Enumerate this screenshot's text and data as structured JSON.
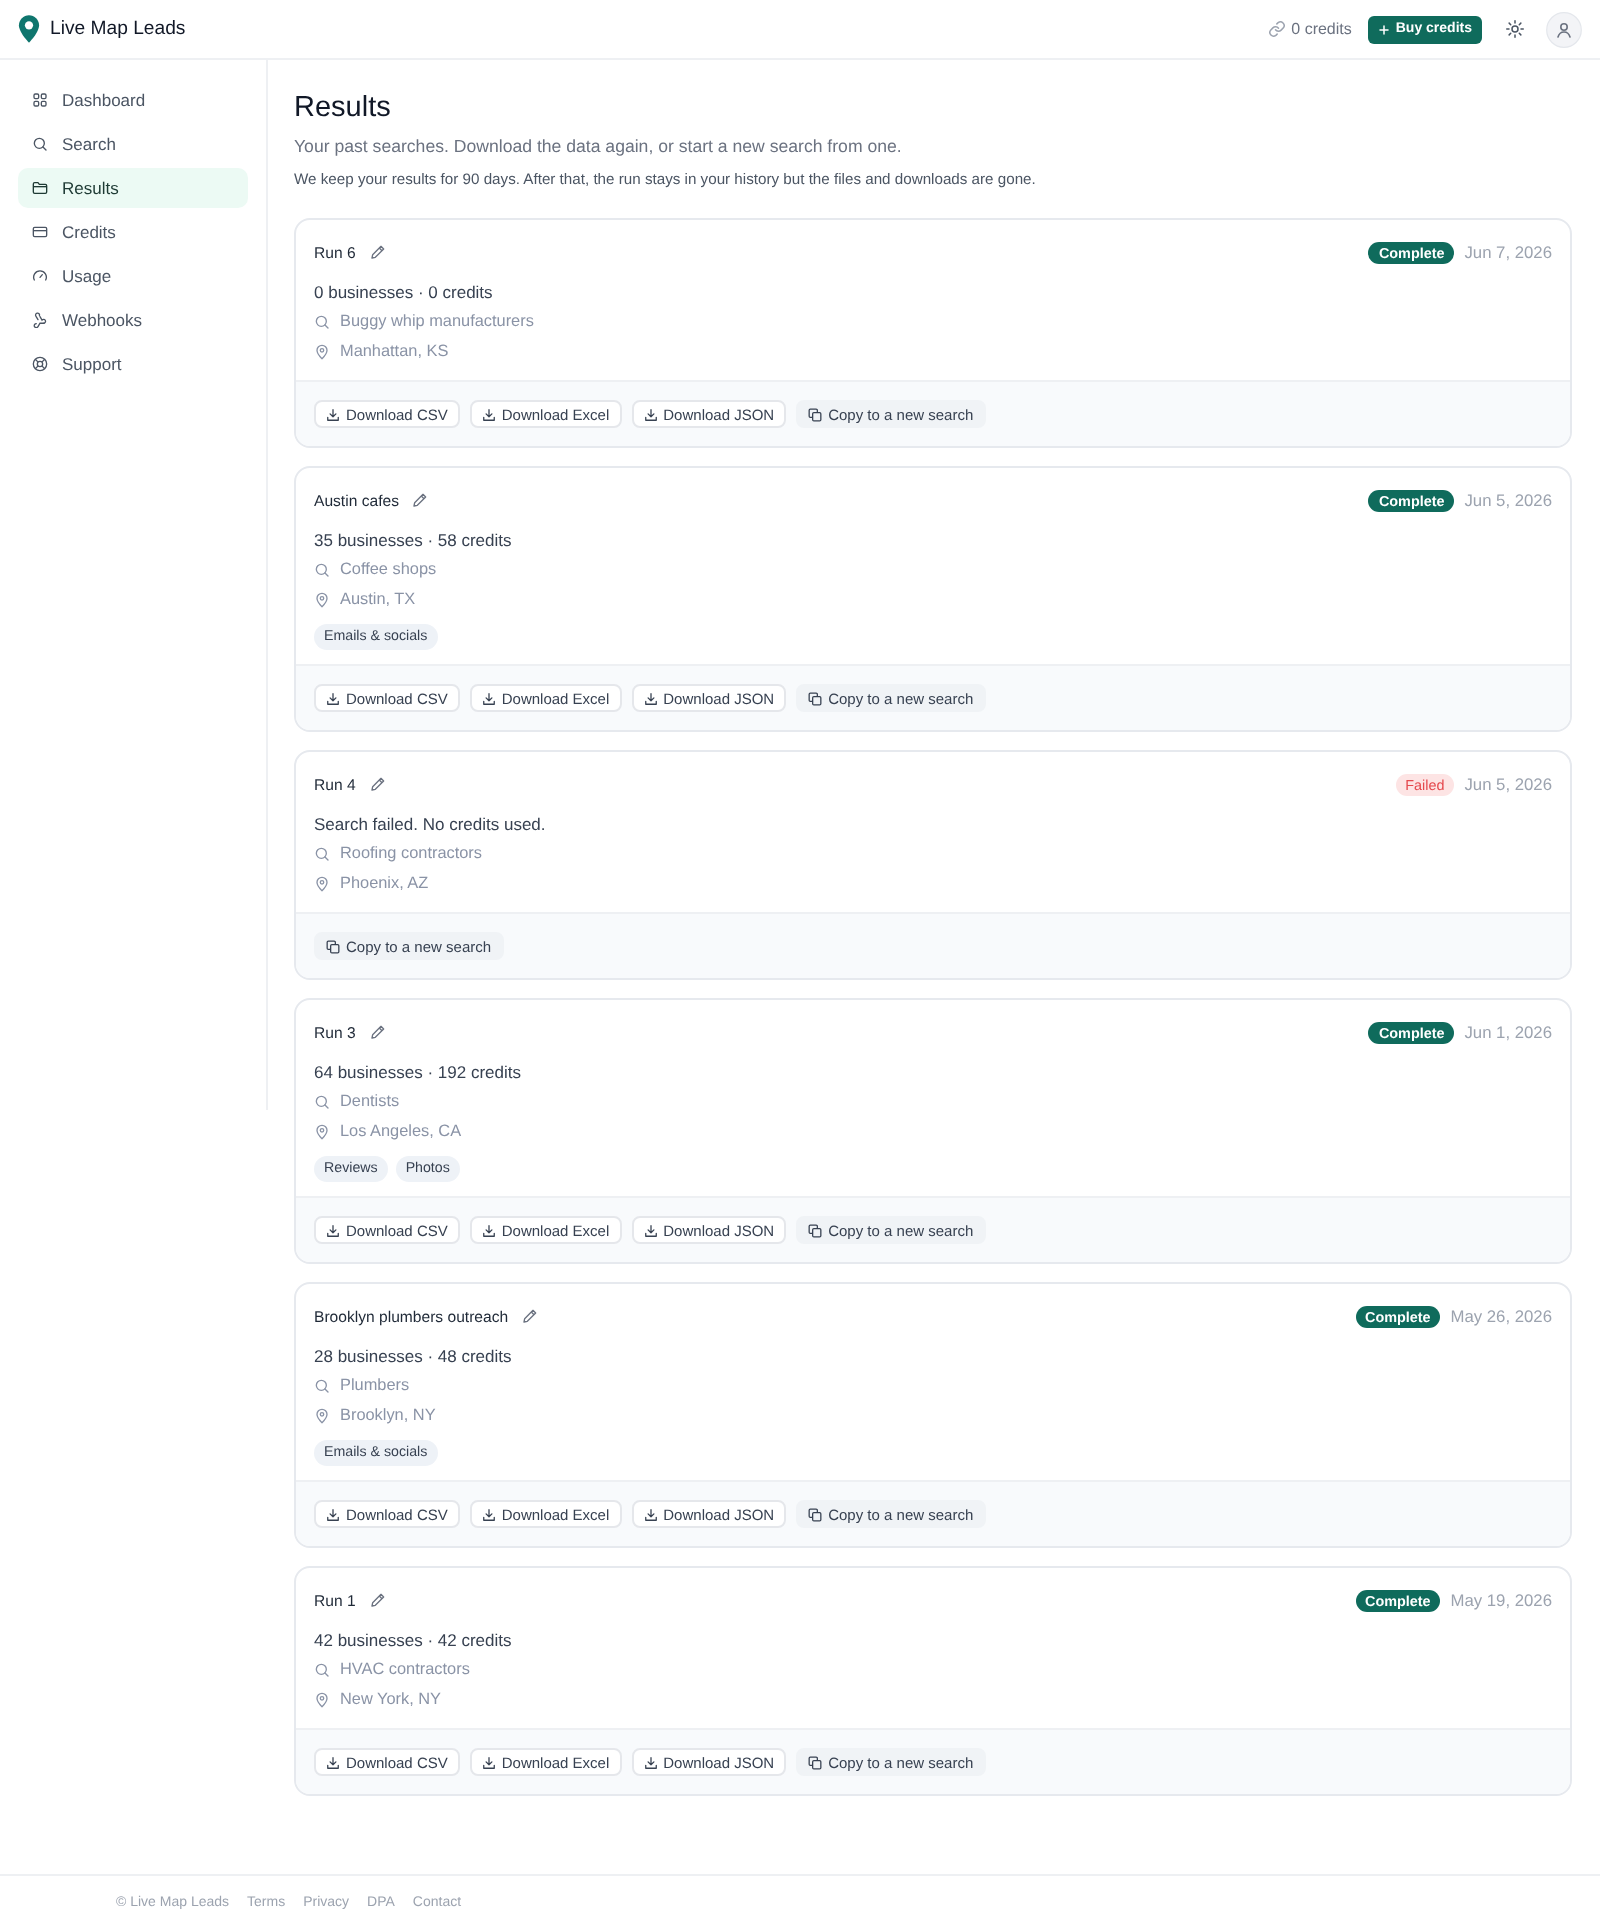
{
  "header": {
    "brand": "Live Map Leads",
    "credits": "0 credits",
    "buy_button": "Buy credits"
  },
  "sidebar": {
    "items": [
      {
        "label": "Dashboard",
        "selected": false
      },
      {
        "label": "Search",
        "selected": false
      },
      {
        "label": "Results",
        "selected": true
      },
      {
        "label": "Credits",
        "selected": false
      },
      {
        "label": "Usage",
        "selected": false
      },
      {
        "label": "Webhooks",
        "selected": false
      },
      {
        "label": "Support",
        "selected": false
      }
    ]
  },
  "page": {
    "title": "Results",
    "subtitle": "Your past searches. Download the data again, or start a new search from one.",
    "note": "We keep your results for 90 days. After that, the run stays in your history but the files and downloads are gone."
  },
  "runs": [
    {
      "name": "Run 6",
      "status": {
        "kind": "complete",
        "label": "Complete"
      },
      "date": "Jun 7, 2026",
      "summary": "0 businesses · 0 credits",
      "query": "Buggy whip manufacturers",
      "location": "Manhattan, KS",
      "actions": [
        {
          "kind": "download",
          "label": "Download CSV"
        },
        {
          "kind": "download",
          "label": "Download Excel"
        },
        {
          "kind": "download",
          "label": "Download JSON"
        },
        {
          "kind": "copy",
          "label": "Copy to a new search"
        }
      ]
    },
    {
      "name": "Austin cafes",
      "status": {
        "kind": "complete",
        "label": "Complete"
      },
      "date": "Jun 5, 2026",
      "summary": "35 businesses · 58 credits",
      "query": "Coffee shops",
      "location": "Austin, TX",
      "tags": [
        "Emails & socials"
      ],
      "actions": [
        {
          "kind": "download",
          "label": "Download CSV"
        },
        {
          "kind": "download",
          "label": "Download Excel"
        },
        {
          "kind": "download",
          "label": "Download JSON"
        },
        {
          "kind": "copy",
          "label": "Copy to a new search"
        }
      ]
    },
    {
      "name": "Run 4",
      "status": {
        "kind": "failed",
        "label": "Failed"
      },
      "date": "Jun 5, 2026",
      "summary": "Search failed. No credits used.",
      "query": "Roofing contractors",
      "location": "Phoenix, AZ",
      "actions": [
        {
          "kind": "copy",
          "label": "Copy to a new search"
        }
      ]
    },
    {
      "name": "Run 3",
      "status": {
        "kind": "complete",
        "label": "Complete"
      },
      "date": "Jun 1, 2026",
      "summary": "64 businesses · 192 credits",
      "query": "Dentists",
      "location": "Los Angeles, CA",
      "tags": [
        "Reviews",
        "Photos"
      ],
      "actions": [
        {
          "kind": "download",
          "label": "Download CSV"
        },
        {
          "kind": "download",
          "label": "Download Excel"
        },
        {
          "kind": "download",
          "label": "Download JSON"
        },
        {
          "kind": "copy",
          "label": "Copy to a new search"
        }
      ]
    },
    {
      "name": "Brooklyn plumbers outreach",
      "status": {
        "kind": "complete",
        "label": "Complete"
      },
      "date": "May 26, 2026",
      "summary": "28 businesses · 48 credits",
      "query": "Plumbers",
      "location": "Brooklyn, NY",
      "tags": [
        "Emails & socials"
      ],
      "actions": [
        {
          "kind": "download",
          "label": "Download CSV"
        },
        {
          "kind": "download",
          "label": "Download Excel"
        },
        {
          "kind": "download",
          "label": "Download JSON"
        },
        {
          "kind": "copy",
          "label": "Copy to a new search"
        }
      ]
    },
    {
      "name": "Run 1",
      "status": {
        "kind": "complete",
        "label": "Complete"
      },
      "date": "May 19, 2026",
      "summary": "42 businesses · 42 credits",
      "query": "HVAC contractors",
      "location": "New York, NY",
      "actions": [
        {
          "kind": "download",
          "label": "Download CSV"
        },
        {
          "kind": "download",
          "label": "Download Excel"
        },
        {
          "kind": "download",
          "label": "Download JSON"
        },
        {
          "kind": "copy",
          "label": "Copy to a new search"
        }
      ]
    }
  ],
  "footer": {
    "copyright": "© Live Map Leads",
    "links": [
      "Terms",
      "Privacy",
      "DPA",
      "Contact"
    ]
  }
}
